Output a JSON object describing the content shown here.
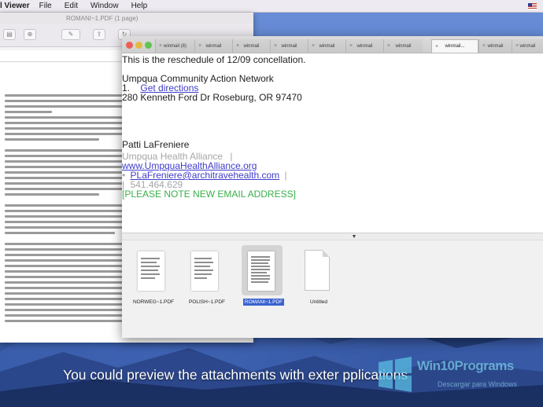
{
  "menubar": {
    "app_name": "l Viewer",
    "items": [
      "File",
      "Edit",
      "Window",
      "Help"
    ]
  },
  "pdf_window": {
    "title": "ROMANI~1.PDF (1 page)"
  },
  "mail_window": {
    "tabs": [
      {
        "label": "winmail (8)"
      },
      {
        "label": "winmail"
      },
      {
        "label": "winmail"
      },
      {
        "label": "winmail"
      },
      {
        "label": "winmail"
      },
      {
        "label": "winmail"
      },
      {
        "label": "winmail"
      },
      {
        "label": "winmail..."
      },
      {
        "label": "winmail"
      },
      {
        "label": "winmail"
      }
    ],
    "body": {
      "line1": "This is the reschedule of 12/09 concellation.",
      "org": "Umpqua Community Action Network",
      "item_number": "1.",
      "directions_link": "Get directions",
      "address": "280 Kenneth Ford Dr Roseburg, OR 97470",
      "name": "Patti LaFreniere",
      "company": "Umpqua Health Alliance",
      "company_sep": "|",
      "website": "www.UmpquaHealthAlliance.org",
      "email_prefix": "•",
      "email": "PLaFreniere@architravehealth.com",
      "email_sep": "|",
      "phone": "541.464.629",
      "phone_sep": "|",
      "notice": "[PLEASE NOTE NEW EMAIL ADDRESS]"
    },
    "attachments": [
      {
        "name": "NORWEG~1.PDF",
        "selected": false
      },
      {
        "name": "POLISH~1.PDF",
        "selected": false
      },
      {
        "name": "ROMANI~1.PDF",
        "selected": true
      },
      {
        "name": "Untitled",
        "selected": false
      }
    ]
  },
  "caption": "You could preview the attachments with exter  pplications",
  "watermark": {
    "brand": "Win10Programs",
    "sub": "Descargar para Windows"
  },
  "colors": {
    "link": "#3f3cc9",
    "signature_gray": "#a6a6a6",
    "notice_green": "#39b04a",
    "selection_blue": "#3a63cf"
  }
}
